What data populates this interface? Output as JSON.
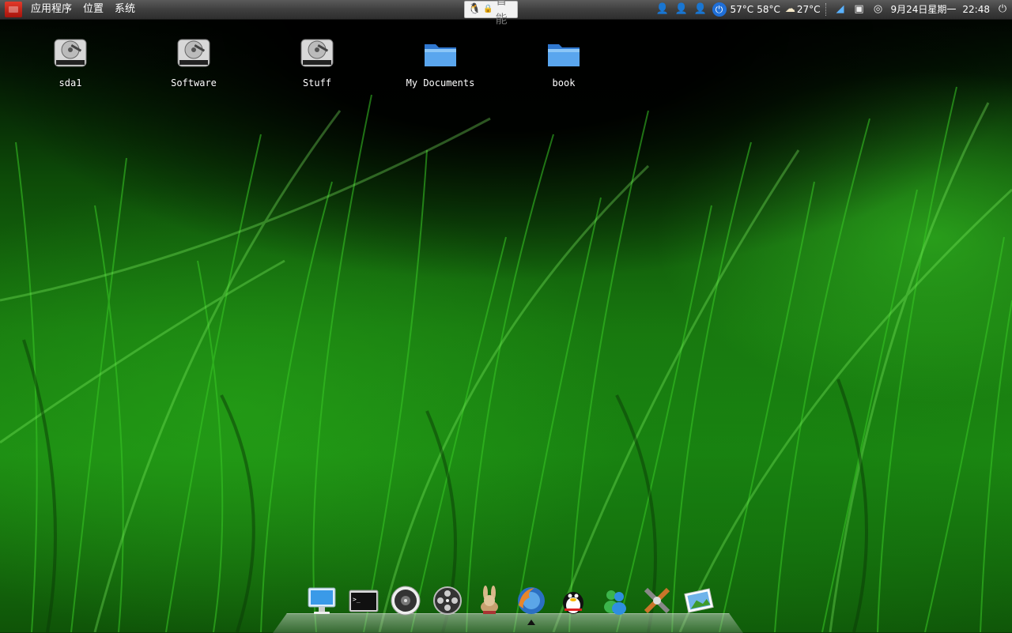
{
  "top_panel": {
    "menus": [
      "应用程序",
      "位置",
      "系统"
    ],
    "input_method": {
      "label": "智能"
    },
    "tray": {
      "temp_cpu1": "57°C",
      "temp_cpu2": "58°C",
      "weather_temp": "27°C",
      "date": "9月24日星期一",
      "time": "22:48"
    }
  },
  "desktop_icons": [
    {
      "label": "sda1",
      "icon": "hard-drive-icon"
    },
    {
      "label": "Software",
      "icon": "hard-drive-icon"
    },
    {
      "label": "Stuff",
      "icon": "hard-drive-icon"
    },
    {
      "label": "My Documents",
      "icon": "folder-icon"
    },
    {
      "label": "book",
      "icon": "folder-icon"
    }
  ],
  "dock": {
    "items": [
      "computer-icon",
      "terminal-icon",
      "disc-icon",
      "film-reel-icon",
      "rabbit-icon",
      "firefox-icon",
      "qq-penguin-icon",
      "messenger-icon",
      "crossover-icon",
      "photo-viewer-icon"
    ],
    "active_item": "firefox-icon"
  },
  "colors": {
    "panel": "#3f3f3f",
    "grass": "#1c8a12",
    "folder": "#4a96e6"
  }
}
